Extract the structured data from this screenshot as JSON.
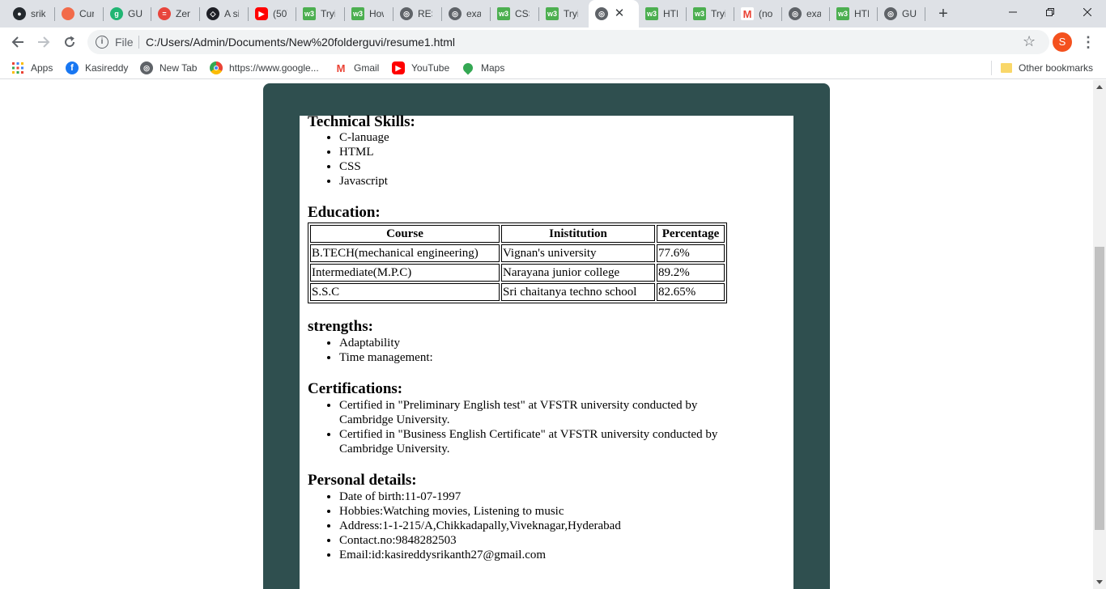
{
  "tabs": [
    {
      "title": "srik",
      "icon": "github-icon",
      "color": "#24292e"
    },
    {
      "title": "Cur",
      "icon": "curious-icon",
      "color": "#f26b4a"
    },
    {
      "title": "GU",
      "icon": "guvi-icon",
      "color": "#21b573"
    },
    {
      "title": "Zen",
      "icon": "zen-icon",
      "color": "#e8453c"
    },
    {
      "title": "A si",
      "icon": "codepen-icon",
      "color": "#1e1f26"
    },
    {
      "title": "(50)",
      "icon": "youtube-icon",
      "color": "#ff0000"
    },
    {
      "title": "Tryi",
      "icon": "w3schools-icon",
      "color": "#4caf50"
    },
    {
      "title": "How",
      "icon": "w3schools-icon",
      "color": "#4caf50"
    },
    {
      "title": "RES",
      "icon": "globe-icon",
      "color": "#5f6368"
    },
    {
      "title": "exa",
      "icon": "globe-icon",
      "color": "#5f6368"
    },
    {
      "title": "CSS",
      "icon": "w3schools-icon",
      "color": "#4caf50"
    },
    {
      "title": "Tryi",
      "icon": "w3schools-icon",
      "color": "#4caf50"
    },
    {
      "title": "",
      "icon": "globe-icon",
      "color": "#5f6368",
      "active": true
    },
    {
      "title": "HTI",
      "icon": "w3schools-icon",
      "color": "#4caf50"
    },
    {
      "title": "Tryi",
      "icon": "w3schools-icon",
      "color": "#4caf50"
    },
    {
      "title": "(no",
      "icon": "gmail-icon",
      "color": "#ea4335"
    },
    {
      "title": "exa",
      "icon": "globe-icon",
      "color": "#5f6368"
    },
    {
      "title": "HTI",
      "icon": "w3schools-icon",
      "color": "#4caf50"
    },
    {
      "title": "GU",
      "icon": "globe-icon",
      "color": "#5f6368"
    }
  ],
  "address_bar": {
    "scheme_label": "File",
    "url": "C:/Users/Admin/Documents/New%20folderguvi/resume1.html"
  },
  "profile_initial": "S",
  "bookmarks": [
    {
      "label": "Apps",
      "icon": "apps-grid-icon"
    },
    {
      "label": "Kasireddy",
      "icon": "facebook-icon"
    },
    {
      "label": "New Tab",
      "icon": "globe-icon"
    },
    {
      "label": "https://www.google...",
      "icon": "chrome-icon"
    },
    {
      "label": "Gmail",
      "icon": "gmail-icon"
    },
    {
      "label": "YouTube",
      "icon": "youtube-icon"
    },
    {
      "label": "Maps",
      "icon": "maps-icon"
    }
  ],
  "other_bookmarks": "Other bookmarks",
  "resume": {
    "technical_skills": {
      "heading": "Technical Skills:",
      "items": [
        "C-lanuage",
        "HTML",
        "CSS",
        "Javascript"
      ]
    },
    "education": {
      "heading": "Education:",
      "columns": [
        "Course",
        "Inistitution",
        "Percentage"
      ],
      "rows": [
        [
          "B.TECH(mechanical engineering)",
          "Vignan's university",
          "77.6%"
        ],
        [
          "Intermediate(M.P.C)",
          "Narayana junior college",
          "89.2%"
        ],
        [
          "S.S.C",
          "Sri chaitanya techno school",
          "82.65%"
        ]
      ]
    },
    "strengths": {
      "heading": "strengths:",
      "items": [
        "Adaptability",
        "Time management:"
      ]
    },
    "certifications": {
      "heading": "Certifications:",
      "items": [
        "Certified in \"Preliminary English test\" at VFSTR university conducted by Cambridge University.",
        "Certified in \"Business English Certificate\" at VFSTR university conducted by Cambridge University."
      ]
    },
    "personal_details": {
      "heading": "Personal details:",
      "items": [
        "Date of birth:11-07-1997",
        "Hobbies:Watching movies, Listening to music",
        "Address:1-1-215/A,Chikkadapally,Viveknagar,Hyderabad",
        "Contact.no:9848282503",
        "Email:id:kasireddysrikanth27@gmail.com"
      ]
    }
  },
  "colors": {
    "frame": "#2f4f4f",
    "tabstrip": "#dee1e6",
    "profile": "#f4511e"
  }
}
